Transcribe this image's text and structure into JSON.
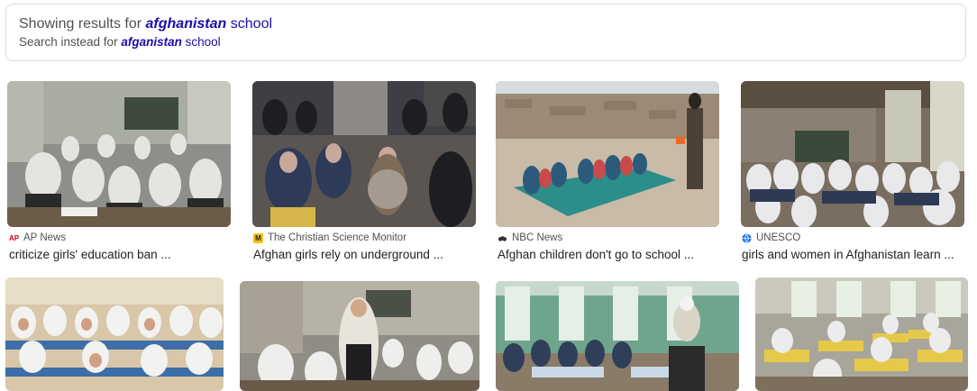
{
  "spelling": {
    "showing_prefix": "Showing results for",
    "corrected_bold": "afghanistan",
    "corrected_rest": "school",
    "instead_prefix": "Search instead for",
    "original_bold": "afganistan",
    "original_rest": "school"
  },
  "results": [
    {
      "source": "AP News",
      "caption": "criticize girls' education ban ...",
      "favicon": "ap-icon"
    },
    {
      "source": "The Christian Science Monitor",
      "caption": "Afghan girls rely on underground ...",
      "favicon": "csmonitor-icon"
    },
    {
      "source": "NBC News",
      "caption": "Afghan children don't go to school ...",
      "favicon": "nbc-icon"
    },
    {
      "source": "UNESCO",
      "caption": "girls and women in Afghanistan learn ...",
      "favicon": "unesco-icon"
    }
  ],
  "favicon_glyphs": {
    "ap": "AP",
    "csm": "M",
    "nbc": "",
    "unesco": ""
  },
  "colors": {
    "link": "#1a0dab",
    "text": "#202124",
    "muted": "#4d5156",
    "border": "#dadce0"
  }
}
